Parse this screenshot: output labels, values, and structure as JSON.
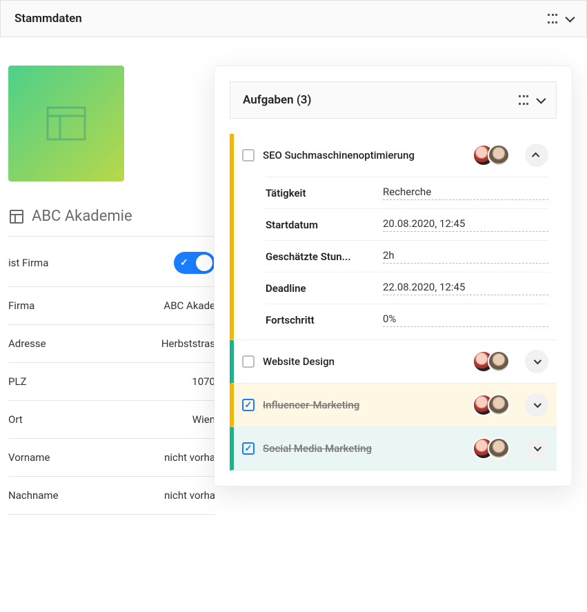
{
  "header": {
    "title": "Stammdaten"
  },
  "profile": {
    "name": "ABC Akademie",
    "fields": {
      "ist_firma": {
        "label": "ist Firma",
        "value": true
      },
      "firma": {
        "label": "Firma",
        "value": "ABC Akade"
      },
      "adresse": {
        "label": "Adresse",
        "value": "Herbststras"
      },
      "plz": {
        "label": "PLZ",
        "value": "1070"
      },
      "ort": {
        "label": "Ort",
        "value": "Wien"
      },
      "vorname": {
        "label": "Vorname",
        "value": "nicht vorha"
      },
      "nachname": {
        "label": "Nachname",
        "value": "nicht vorha"
      }
    }
  },
  "tasks": {
    "header": "Aufgaben (3)",
    "items": [
      {
        "title": "SEO Suchmaschinenoptimierung",
        "done": false,
        "expanded": true,
        "color": "yellow",
        "details": {
          "taetigkeit": {
            "label": "Tätigkeit",
            "value": "Recherche"
          },
          "startdatum": {
            "label": "Startdatum",
            "value": "20.08.2020, 12:45"
          },
          "stunden": {
            "label": "Geschätzte Stun...",
            "value": "2h"
          },
          "deadline": {
            "label": "Deadline",
            "value": "22.08.2020, 12:45"
          },
          "fortschritt": {
            "label": "Fortschritt",
            "value": "0%"
          }
        }
      },
      {
        "title": "Website Design",
        "done": false,
        "expanded": false,
        "color": "teal"
      },
      {
        "title": "Influencer-Marketing",
        "done": true,
        "expanded": false,
        "color": "yellow"
      },
      {
        "title": "Social Media Marketing",
        "done": true,
        "expanded": false,
        "color": "teal"
      }
    ]
  }
}
